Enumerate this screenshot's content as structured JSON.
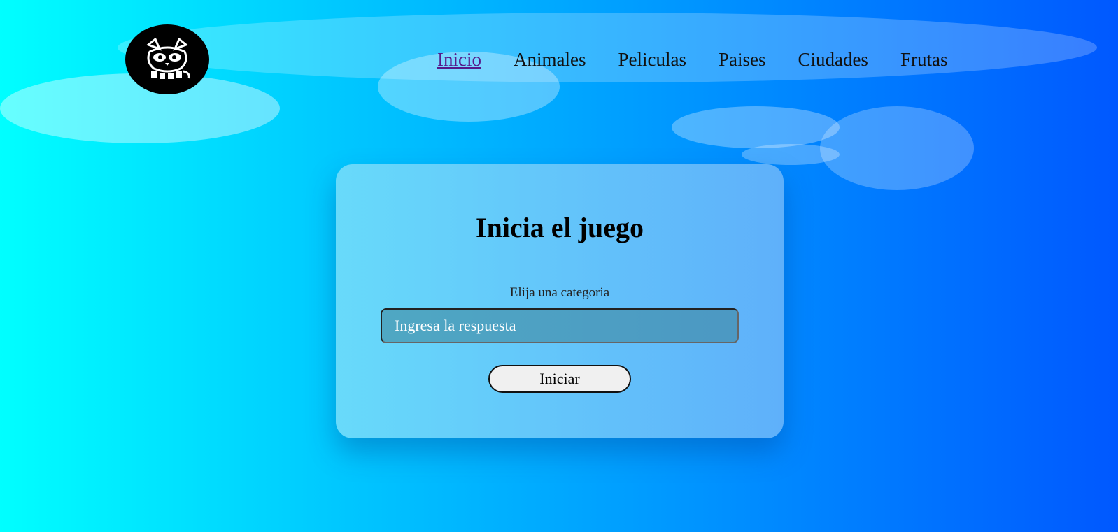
{
  "nav": {
    "items": [
      {
        "label": "Inicio",
        "active": true
      },
      {
        "label": "Animales",
        "active": false
      },
      {
        "label": "Peliculas",
        "active": false
      },
      {
        "label": "Paises",
        "active": false
      },
      {
        "label": "Ciudades",
        "active": false
      },
      {
        "label": "Frutas",
        "active": false
      }
    ]
  },
  "logo": {
    "icon": "raccoon-icon"
  },
  "game": {
    "title": "Inicia el juego",
    "category_label": "Elija una categoria",
    "answer_placeholder": "Ingresa la respuesta",
    "answer_value": "",
    "start_label": "Iniciar"
  },
  "colors": {
    "background_start": "#00ffff",
    "background_end": "#0058ff",
    "active_link": "#551a8b",
    "logo_bg": "#000000"
  }
}
